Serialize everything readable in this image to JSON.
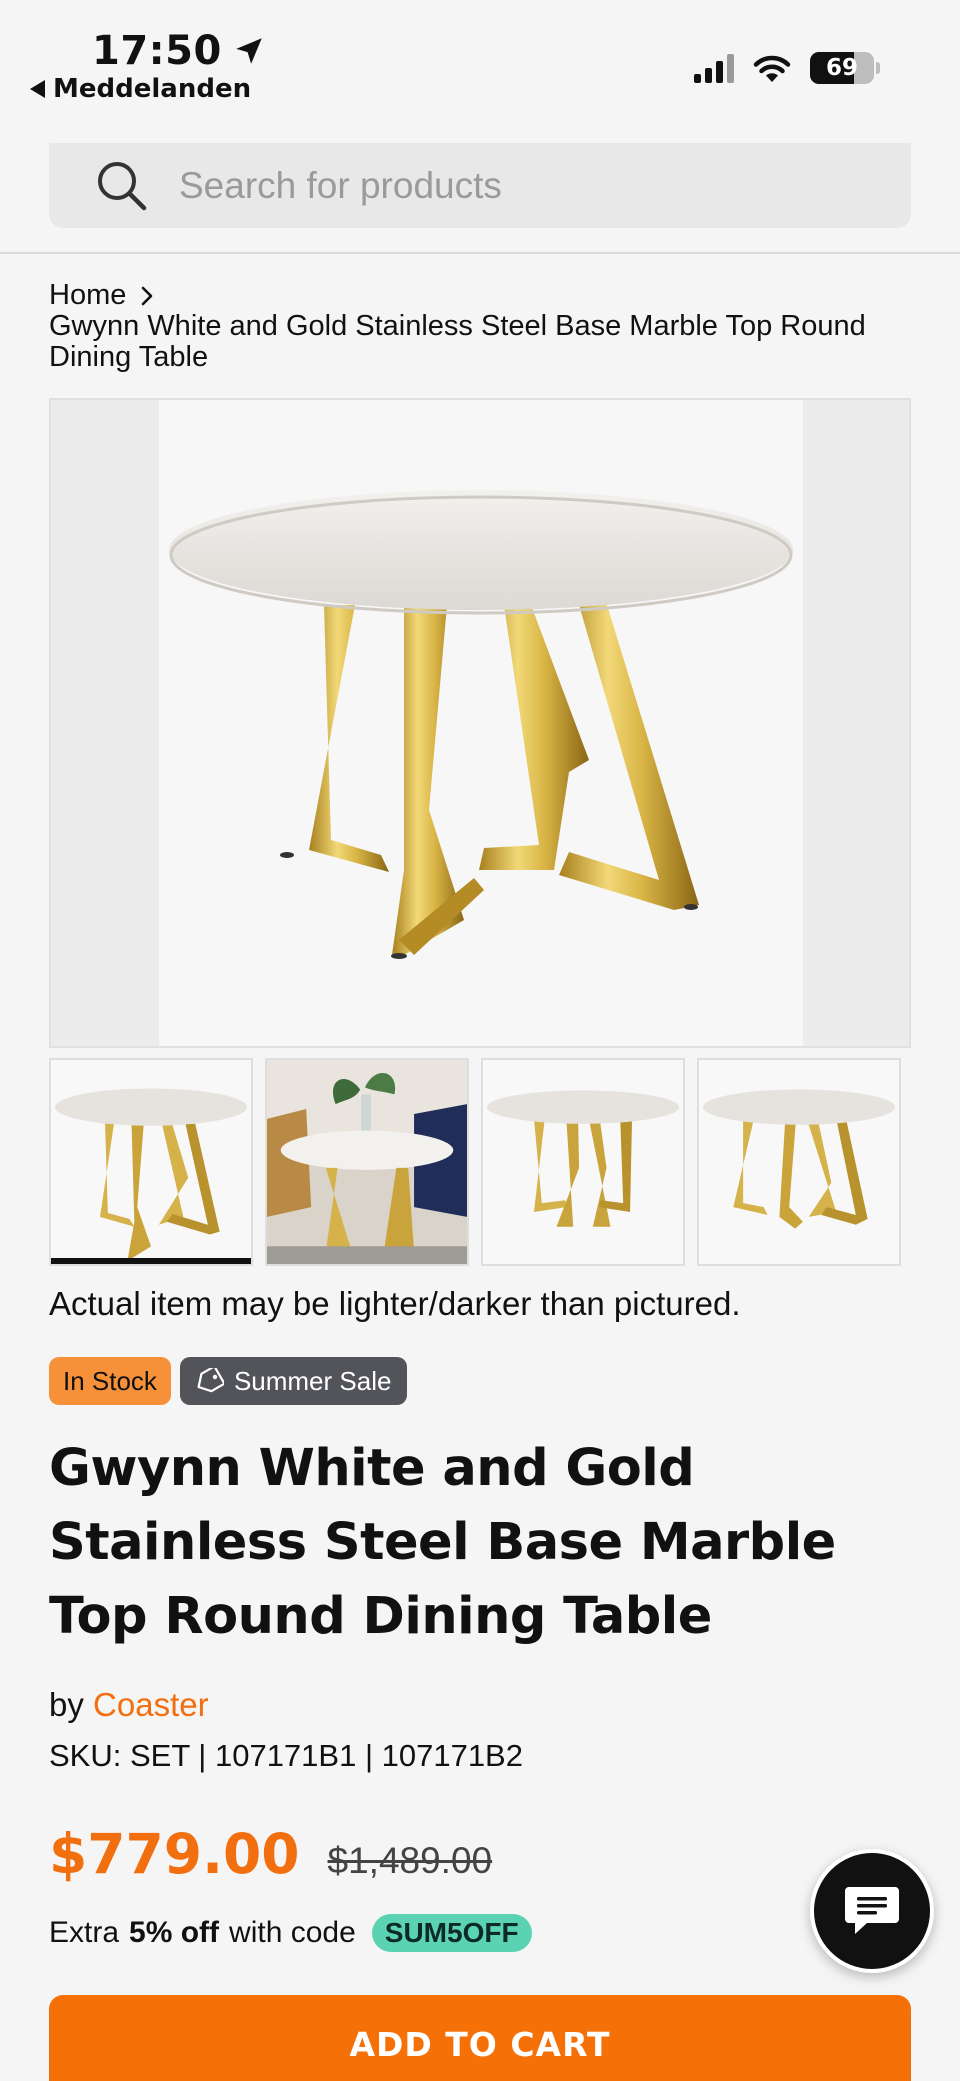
{
  "status_bar": {
    "time": "17:50",
    "back_label": "Meddelanden",
    "battery_percent": 69,
    "battery_text": "69"
  },
  "search": {
    "placeholder": "Search for products",
    "value": ""
  },
  "breadcrumb": {
    "home": "Home",
    "current": "Gwynn White and Gold Stainless Steel Base Marble Top Round Dining Table"
  },
  "gallery": {
    "thumbnail_count": 4,
    "active_index": 0
  },
  "disclaimer": "Actual item may be lighter/darker than pictured.",
  "badges": {
    "stock": "In Stock",
    "sale": "Summer Sale"
  },
  "product": {
    "title": "Gwynn White and Gold Stainless Steel Base Marble Top Round Dining Table",
    "by_prefix": "by",
    "brand": "Coaster",
    "sku": "SKU: SET | 107171B1 | 107171B2"
  },
  "pricing": {
    "price": "$779.00",
    "original_price": "$1,489.00",
    "promo_prefix": "Extra",
    "promo_discount": "5% off",
    "promo_middle": "with code",
    "promo_code": "SUM5OFF"
  },
  "actions": {
    "add_to_cart": "ADD TO CART"
  },
  "colors": {
    "accent": "#f26f10",
    "button": "#f57108",
    "stock_badge": "#f6913a",
    "sale_badge": "#52545a",
    "promo_code": "#5bd3b3"
  },
  "icons": {
    "location": "location-arrow-icon",
    "search": "search-icon",
    "tag": "tag-icon",
    "chat": "chat-icon",
    "chevron": "chevron-right-icon"
  }
}
